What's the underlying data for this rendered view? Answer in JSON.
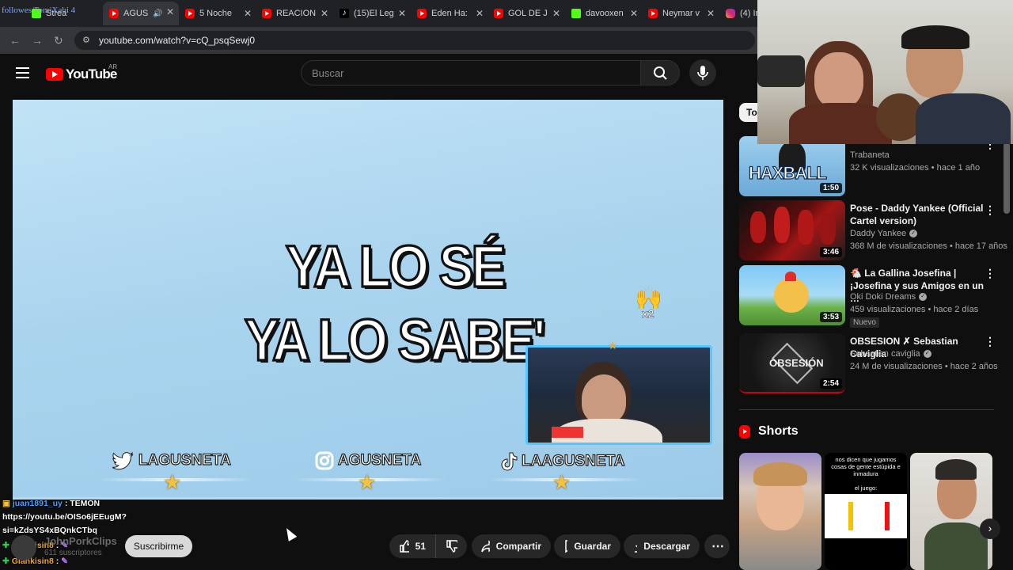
{
  "browser": {
    "tabs": [
      {
        "label": "Strea",
        "icon": "green-k-icon",
        "overlay": "followes TomiXabi 4"
      },
      {
        "label": "AGUS",
        "icon": "youtube-icon",
        "active": true
      },
      {
        "label": "5 Noche",
        "icon": "youtube-icon"
      },
      {
        "label": "REACION",
        "icon": "youtube-icon"
      },
      {
        "label": "(15)El Leg",
        "icon": "tiktok-icon"
      },
      {
        "label": "Eden Ha:",
        "icon": "youtube-icon"
      },
      {
        "label": "GOL DE J",
        "icon": "youtube-icon"
      },
      {
        "label": "davooxen",
        "icon": "green-k-icon"
      },
      {
        "label": "Neymar v",
        "icon": "youtube-icon"
      },
      {
        "label": "(4) In",
        "icon": "instagram-icon"
      }
    ],
    "url": "youtube.com/watch?v=cQ_psqSewj0"
  },
  "youtube": {
    "logo_text": "YouTube",
    "country_code": "AR",
    "search_placeholder": "Buscar"
  },
  "video": {
    "line1": "YA LO SÉ",
    "line2": "YA LO SABE'",
    "multiplier": "x2",
    "socials": [
      {
        "icon": "twitter-icon",
        "handle": "LAGUSNETA"
      },
      {
        "icon": "instagram-icon",
        "handle": "AGUSNETA"
      },
      {
        "icon": "tiktok-icon",
        "handle": "LAAGUSNETA"
      }
    ],
    "progress_fraction": 0.0
  },
  "chat": [
    {
      "user": "juan1891_uy",
      "message": ": TEMON"
    },
    {
      "user": "",
      "message": "https://youtu.be/OISo6jEEugM?"
    },
    {
      "user": "",
      "message": "si=kZdsYS4xBQnkCTbq"
    },
    {
      "user": "Giankisin8",
      "message": ":"
    },
    {
      "user": "Giankisin8",
      "message": ":"
    }
  ],
  "channel": {
    "name": "JohnPorkClips",
    "subscribers": "611 suscriptores",
    "subscribe_label": "Suscribirme"
  },
  "actions": {
    "likes": "51",
    "share": "Compartir",
    "save": "Guardar",
    "download": "Descargar"
  },
  "sidebar": {
    "chip_all": "Todo",
    "recommendations": [
      {
        "title": "",
        "channel": "Trabaneta",
        "verified": false,
        "meta": "32 K visualizaciones • hace 1 año",
        "duration": "1:50",
        "thumb_text": "HAXBALL",
        "badge": ""
      },
      {
        "title": "Pose - Daddy Yankee (Official Cartel version)",
        "channel": "Daddy Yankee",
        "verified": true,
        "meta": "368 M de visualizaciones • hace 17 años",
        "duration": "3:46",
        "thumb_text": "",
        "badge": ""
      },
      {
        "title": "🐔 La Gallina Josefina | ¡Josefina y sus Amigos en un …",
        "channel": "Oki Doki Dreams",
        "verified": true,
        "meta": "459 visualizaciones • hace 2 días",
        "duration": "3:53",
        "thumb_text": "",
        "badge": "Nuevo"
      },
      {
        "title": "OBSESION ✗ Sebastian Caviglia",
        "channel": "Sebastian caviglia",
        "verified": true,
        "meta": "24 M de visualizaciones • hace 2 años",
        "duration": "2:54",
        "thumb_text": "OBSESIÓN",
        "badge": ""
      }
    ],
    "shorts_title": "Shorts",
    "shorts": [
      {
        "caption": ""
      },
      {
        "caption": "nos dicen que jugamos cosas de gente estúpida e inmadura",
        "sub": "el juego:"
      },
      {
        "caption": ""
      }
    ]
  }
}
